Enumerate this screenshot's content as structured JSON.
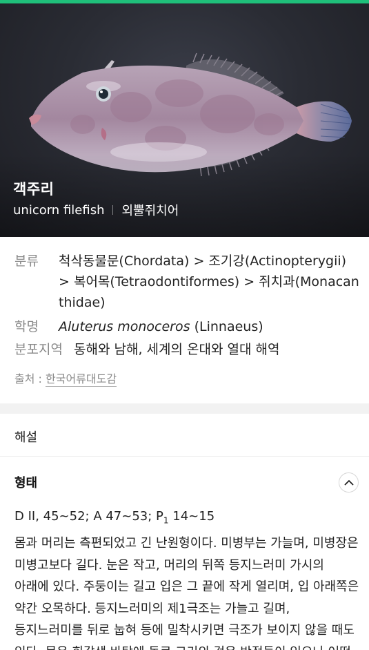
{
  "colors": {
    "accent": "#1fbf7a",
    "label": "#8a8a8a",
    "text": "#222222"
  },
  "hero": {
    "image": "fish-photo",
    "title": "객주리",
    "english_name": "unicorn filefish",
    "alt_name": "외뿔쥐치어"
  },
  "info": {
    "classification_label": "분류",
    "classification_value": "척삭동물문(Chordata) > 조기강(Actinopterygii) > 복어목(Tetraodontiformes) > 쥐치과(Monacanthidae)",
    "scientific_label": "학명",
    "scientific_genus_species": "Aluterus monoceros",
    "scientific_author": "(Linnaeus)",
    "distribution_label": "분포지역",
    "distribution_value": "동해와 남해, 세계의 온대와 열대 해역",
    "source_prefix": "출처 : ",
    "source_link": "한국어류대도감"
  },
  "commentary": {
    "title": "해설"
  },
  "morphology": {
    "title": "형태",
    "collapse_icon": "chevron-up-icon",
    "formula_main": "D II, 45~52; A 47~53; P",
    "formula_sub": "1",
    "formula_tail": " 14~15",
    "description": "몸과 머리는 측편되었고 긴 난원형이다. 미병부는 가늘며, 미병장은 미병고보다 길다. 눈은 작고, 머리의 뒤쪽 등지느러미 가시의 아래에 있다. 주둥이는 길고 입은 그 끝에 작게 열리며, 입 아래쪽은 약간 오목하다. 등지느러미의 제1극조는 가늘고 길며, 등지느러미를 뒤로 눕혀 등에 밀착시키면 극조가 보이지 않을 때도 있다. 몸은 회갈색 바탕에 돌로 크기의 검은 반점들이 있으나 어떤"
  }
}
